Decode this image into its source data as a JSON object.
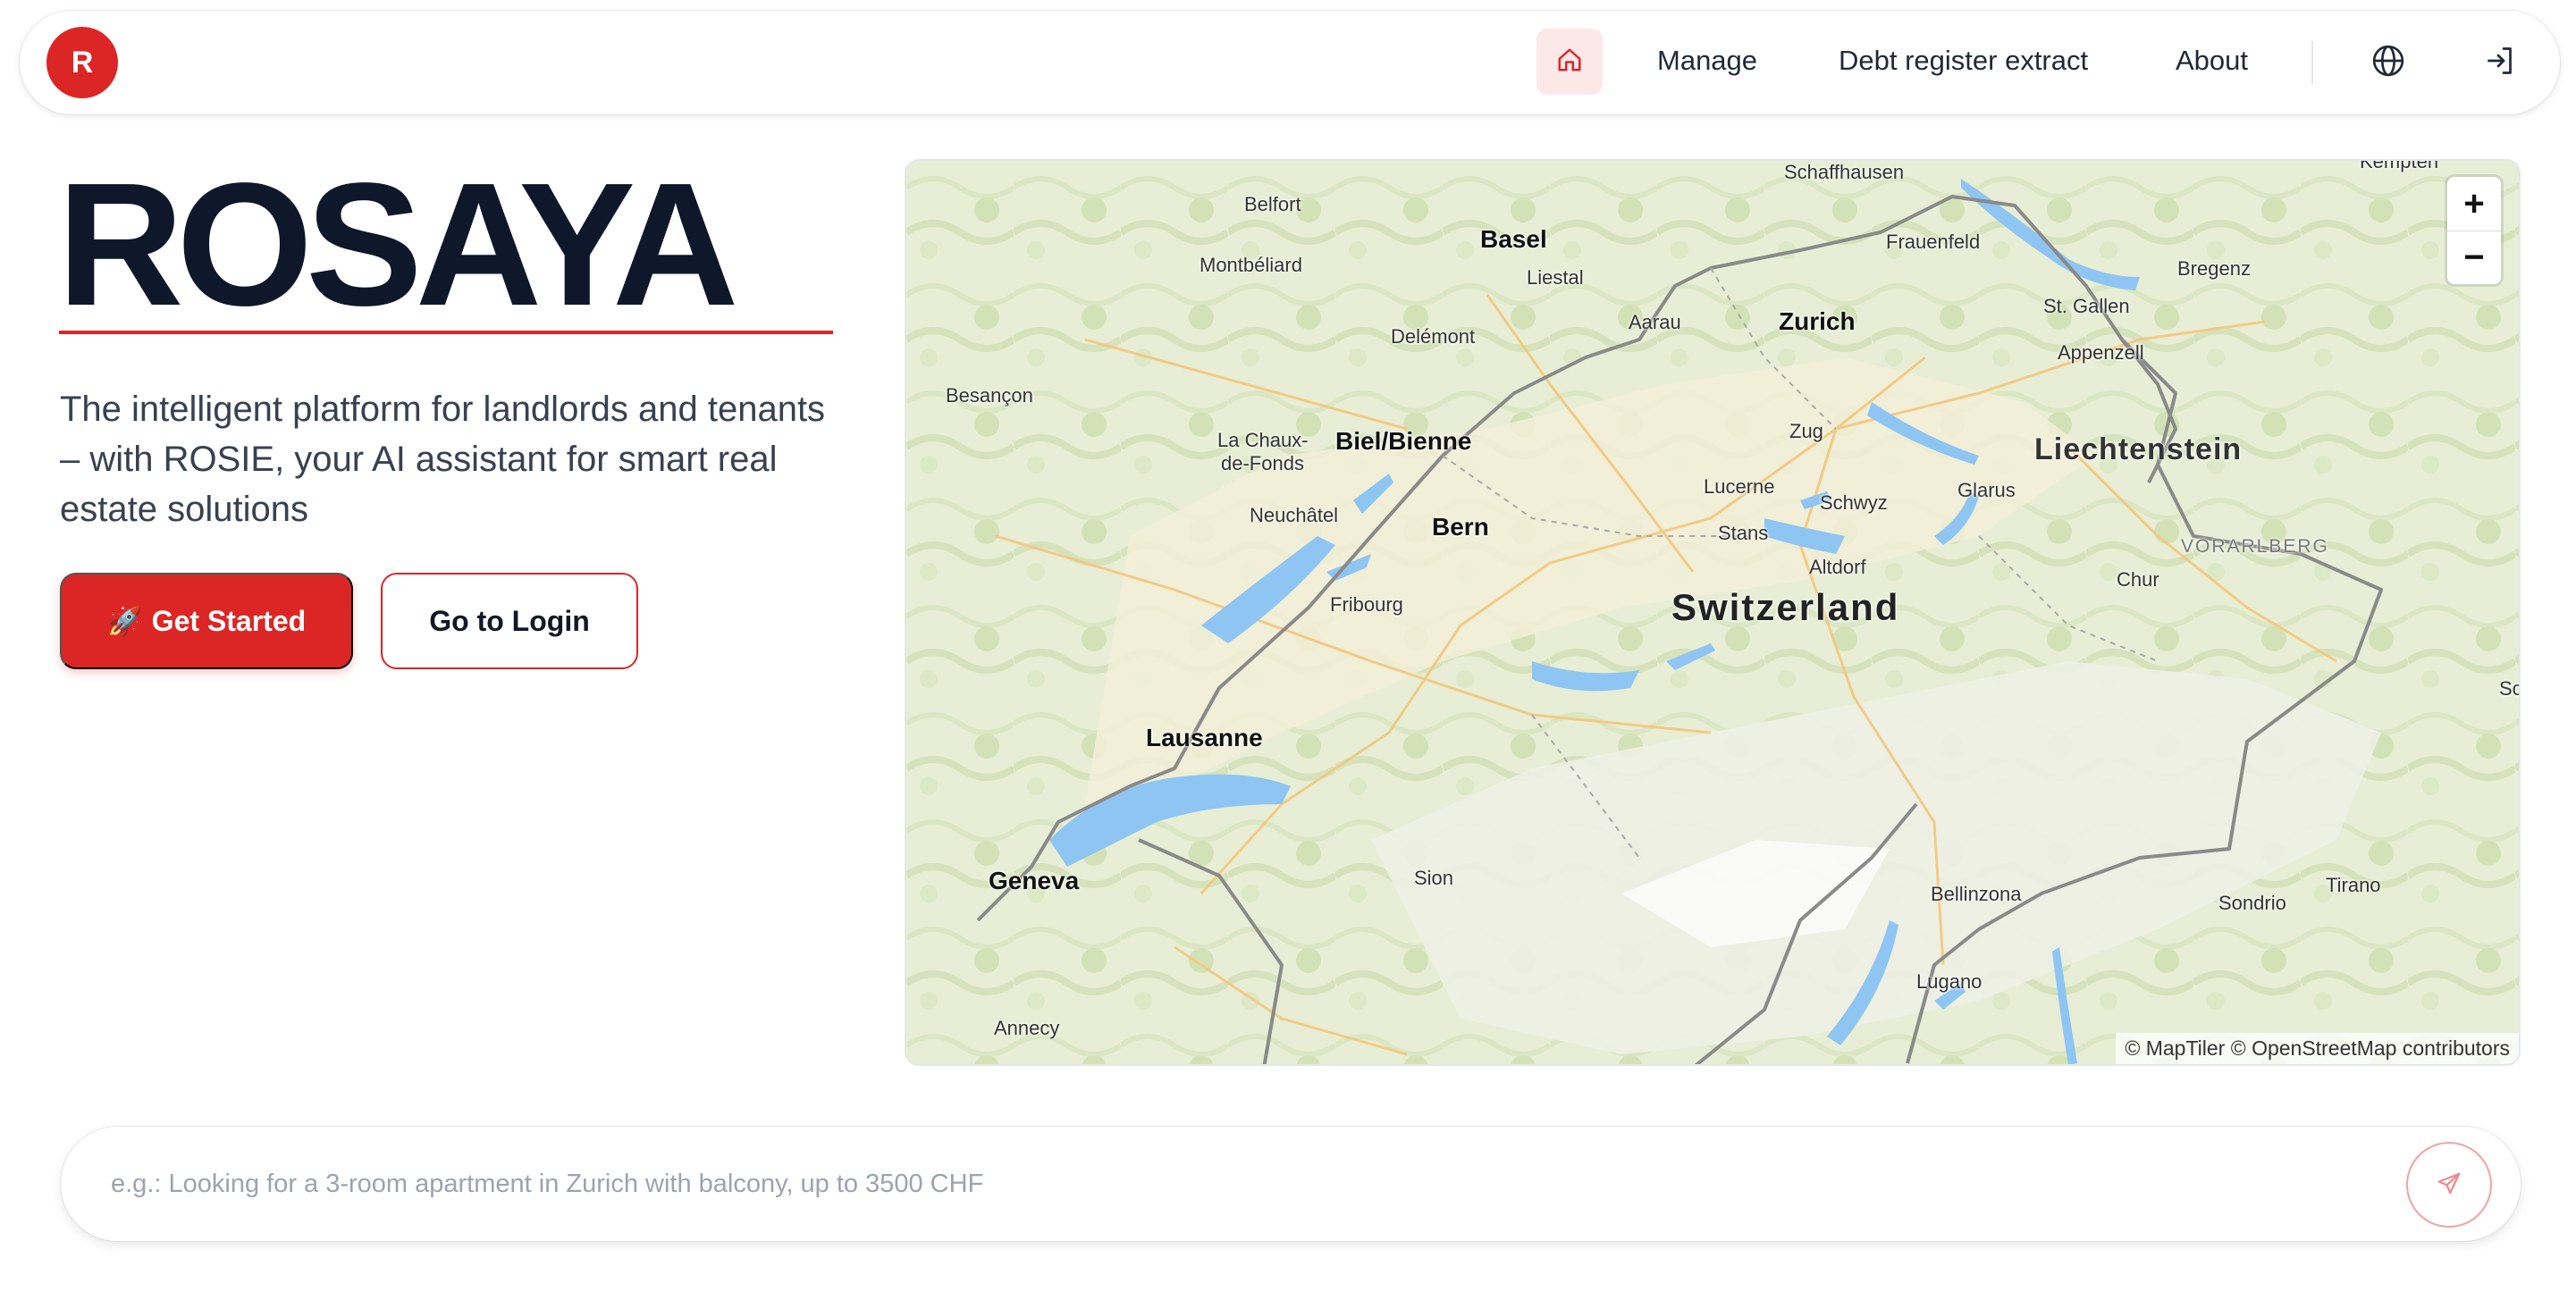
{
  "nav": {
    "logo_letter": "R",
    "links": {
      "manage": "Manage",
      "debt": "Debt register extract",
      "about": "About"
    },
    "icons": {
      "home": "home-icon",
      "language": "globe-icon",
      "login": "login-icon"
    }
  },
  "hero": {
    "brand": "ROSAYA",
    "tagline": "The intelligent platform for landlords and tenants – with ROSIE, your AI assistant for smart real estate solutions",
    "primary_emoji": "🚀",
    "primary_label": "Get Started",
    "secondary_label": "Go to Login"
  },
  "map": {
    "attribution": "© MapTiler © OpenStreetMap contributors",
    "zoom_in": "+",
    "zoom_out": "−",
    "country": "Switzerland",
    "region": "Liechtenstein",
    "area": "VORARLBERG",
    "cities": [
      "Zurich",
      "Bern",
      "Geneva",
      "Lausanne",
      "Basel",
      "Biel/Bienne"
    ],
    "places": [
      "Schaffhausen",
      "Belfort",
      "Frauenfeld",
      "Bregenz",
      "Montbéliard",
      "Liestal",
      "Aarau",
      "St. Gallen",
      "Delémont",
      "Appenzell",
      "Besançon",
      "La Chaux-",
      "de-Fonds",
      "Zug",
      "Lucerne",
      "Glarus",
      "Schwyz",
      "Neuchâtel",
      "Stans",
      "Chur",
      "Altdorf",
      "Fribourg",
      "Sion",
      "Bellinzona",
      "Sondrio",
      "Tirano",
      "Lugano",
      "Annecy",
      "Kempten",
      "Sc"
    ]
  },
  "search": {
    "placeholder": "e.g.: Looking for a 3-room apartment in Zurich with balcony, up to 3500 CHF"
  },
  "colors": {
    "accent": "#dc2626",
    "brand_text": "#0f172a"
  }
}
